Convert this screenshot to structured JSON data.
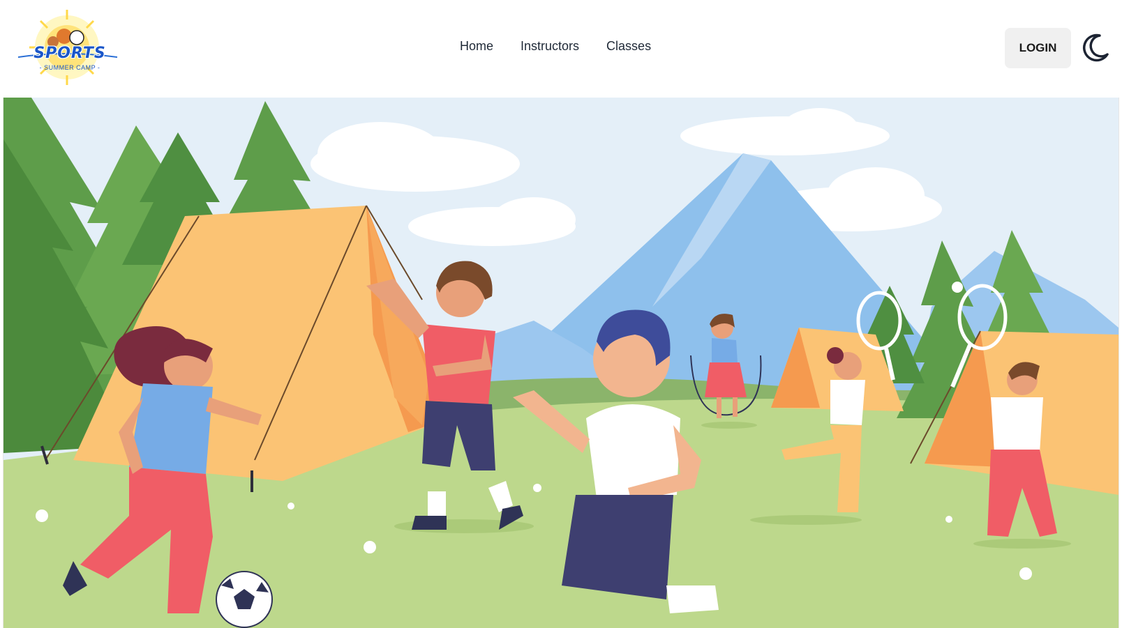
{
  "brand": {
    "logo_text": "SPORTS",
    "logo_subtext": "- SUMMER CAMP -"
  },
  "nav": {
    "links": [
      {
        "label": "Home"
      },
      {
        "label": "Instructors"
      },
      {
        "label": "Classes"
      }
    ],
    "login_label": "LOGIN",
    "theme_icon": "moon-icon"
  },
  "hero": {
    "illustration": "summer-camp-scene"
  },
  "colors": {
    "sky": "#e4eff8",
    "grass": "#bdd88c",
    "tent": "#fbbd6e",
    "tree": "#5e9d4a",
    "mountain": "#8ec0ec"
  }
}
